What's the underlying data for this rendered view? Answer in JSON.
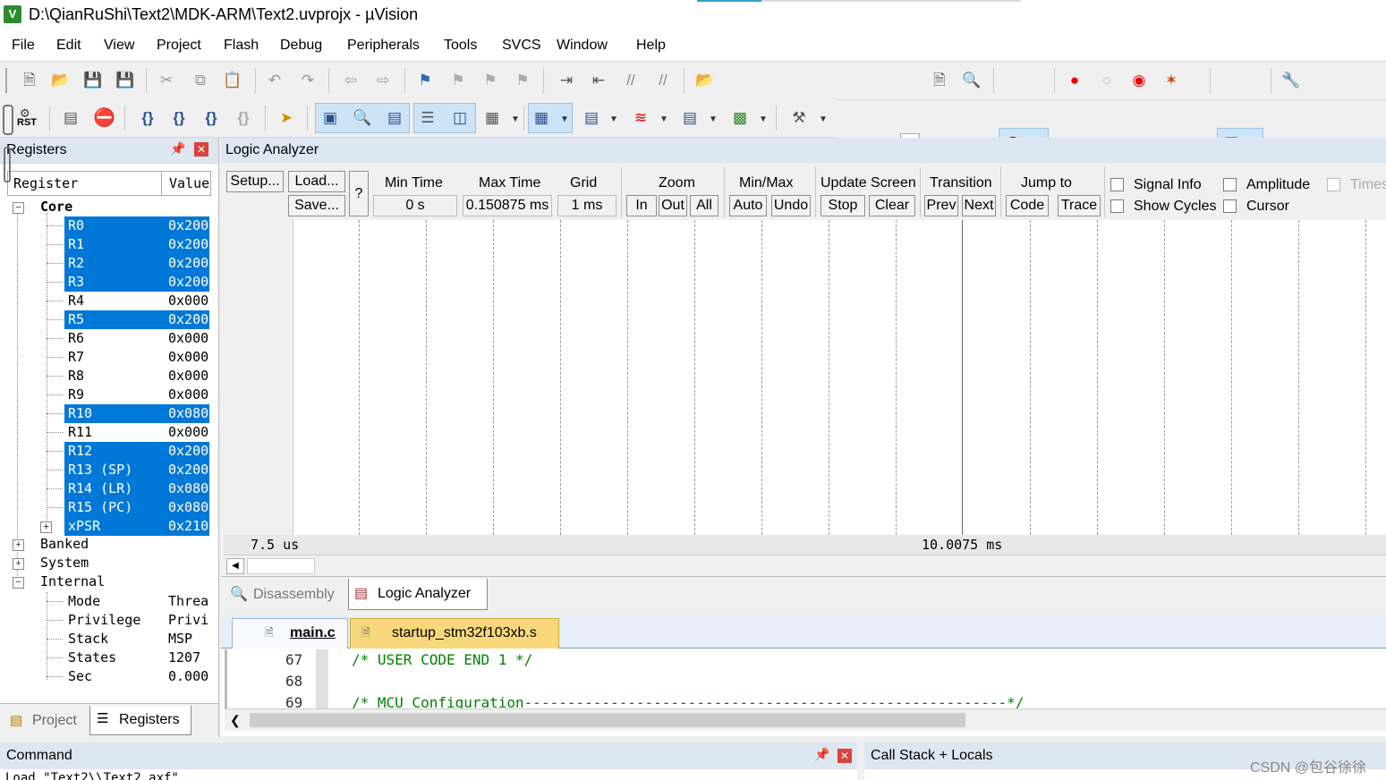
{
  "window": {
    "title": "D:\\QianRuShi\\Text2\\MDK-ARM\\Text2.uvprojx - µVision",
    "app_icon": "uv-app-icon"
  },
  "menu": [
    "File",
    "Edit",
    "View",
    "Project",
    "Flash",
    "Debug",
    "Peripherals",
    "Tools",
    "SVCS",
    "Window",
    "Help"
  ],
  "toolbar1_icons": [
    "new-file-icon",
    "open-folder-icon",
    "save-icon",
    "save-all-icon",
    "cut-icon",
    "copy-icon",
    "paste-icon",
    "undo-icon",
    "redo-icon",
    "back-icon",
    "forward-icon",
    "bookmark-icon",
    "bookmark-prev-icon",
    "bookmark-next-icon",
    "bookmark-clear-icon",
    "indent-icon",
    "unindent-icon",
    "comment-icon",
    "uncomment-icon",
    "find-in-files-icon",
    "find-icon",
    "incremental-find-icon",
    "debug-session-icon",
    "breakpoint-insert-icon",
    "breakpoint-enable-icon",
    "breakpoint-disable-icon",
    "breakpoint-kill-icon",
    "window-layout-icon",
    "configure-icon"
  ],
  "toolbar2": {
    "rst_label": "RST",
    "icons": [
      "reset-icon",
      "run-icon",
      "stop-icon",
      "step-into-icon",
      "step-over-icon",
      "step-out-icon",
      "run-to-cursor-icon",
      "show-next-statement-icon",
      "command-window-icon",
      "disassembly-window-icon",
      "symbols-window-icon",
      "registers-window-icon",
      "call-stack-window-icon",
      "watch-window-icon",
      "memory-window-icon",
      "serial-window-icon",
      "analysis-window-icon",
      "trace-window-icon",
      "system-viewer-icon",
      "toolbox-icon"
    ]
  },
  "registers_panel": {
    "title": "Registers",
    "col_register": "Register",
    "col_value": "Value",
    "core_label": "Core",
    "core_rows": [
      {
        "name": "R0",
        "value": "0x200",
        "selected": true
      },
      {
        "name": "R1",
        "value": "0x200",
        "selected": true
      },
      {
        "name": "R2",
        "value": "0x200",
        "selected": true
      },
      {
        "name": "R3",
        "value": "0x200",
        "selected": true
      },
      {
        "name": "R4",
        "value": "0x000",
        "selected": false
      },
      {
        "name": "R5",
        "value": "0x200",
        "selected": true
      },
      {
        "name": "R6",
        "value": "0x000",
        "selected": false
      },
      {
        "name": "R7",
        "value": "0x000",
        "selected": false
      },
      {
        "name": "R8",
        "value": "0x000",
        "selected": false
      },
      {
        "name": "R9",
        "value": "0x000",
        "selected": false
      },
      {
        "name": "R10",
        "value": "0x080",
        "selected": true
      },
      {
        "name": "R11",
        "value": "0x000",
        "selected": false
      },
      {
        "name": "R12",
        "value": "0x200",
        "selected": true
      },
      {
        "name": "R13 (SP)",
        "value": "0x200",
        "selected": true
      },
      {
        "name": "R14 (LR)",
        "value": "0x080",
        "selected": true
      },
      {
        "name": "R15 (PC)",
        "value": "0x080",
        "selected": true
      },
      {
        "name": "xPSR",
        "value": "0x210",
        "selected": true
      }
    ],
    "groups": [
      "Banked",
      "System",
      "Internal"
    ],
    "internal_rows": [
      {
        "name": "Mode",
        "value": "Threa"
      },
      {
        "name": "Privilege",
        "value": "Privi"
      },
      {
        "name": "Stack",
        "value": "MSP"
      },
      {
        "name": "States",
        "value": "1207"
      },
      {
        "name": "Sec",
        "value": "0.000"
      }
    ],
    "bottom_tabs": [
      "Project",
      "Registers"
    ]
  },
  "logic_analyzer": {
    "title": "Logic Analyzer",
    "setup": "Setup...",
    "load": "Load...",
    "save": "Save...",
    "help": "?",
    "min_time_label": "Min Time",
    "min_time_value": "0 s",
    "max_time_label": "Max Time",
    "max_time_value": "0.150875 ms",
    "grid_label": "Grid",
    "grid_value": "1 ms",
    "zoom_label": "Zoom",
    "zoom_in": "In",
    "zoom_out": "Out",
    "zoom_all": "All",
    "minmax_label": "Min/Max",
    "minmax_auto": "Auto",
    "minmax_undo": "Undo",
    "update_label": "Update Screen",
    "update_stop": "Stop",
    "update_clear": "Clear",
    "transition_label": "Transition",
    "transition_prev": "Prev",
    "transition_next": "Next",
    "jump_label": "Jump to",
    "jump_code": "Code",
    "jump_trace": "Trace",
    "signal_info": "Signal Info",
    "show_cycles": "Show Cycles",
    "amplitude": "Amplitude",
    "cursor": "Cursor",
    "timestamps": "Times",
    "time_left": "7.5 us",
    "time_right": "10.0075 ms"
  },
  "view_tabs": [
    "Disassembly",
    "Logic Analyzer"
  ],
  "editor": {
    "tabs": [
      "main.c",
      "startup_stm32f103xb.s"
    ],
    "lines": [
      {
        "num": "67",
        "text": "/* USER CODE END 1 */"
      },
      {
        "num": "68",
        "text": ""
      },
      {
        "num": "69",
        "text": "/* MCU Configuration--------------------------------------------------------*/"
      }
    ]
  },
  "command_panel": {
    "title": "Command",
    "content": "Load \"Text2\\\\Text2.axf\""
  },
  "callstack_panel": {
    "title": "Call Stack + Locals"
  },
  "watermark": "CSDN @包谷徐徐",
  "colors": {
    "selection": "#0078d7",
    "panel_header": "#dde7f2",
    "comment_green": "#008000"
  }
}
